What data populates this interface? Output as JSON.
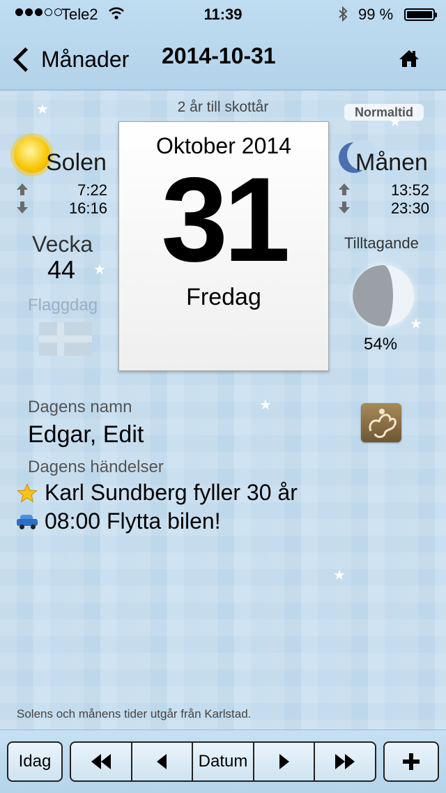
{
  "status_bar": {
    "carrier": "Tele2",
    "time": "11:39",
    "battery_pct": "99 %",
    "signal_bars_filled": 3,
    "signal_bars_total": 5
  },
  "nav": {
    "back_label": "Månader",
    "title": "2014-10-31",
    "home_icon": "home-icon"
  },
  "calendar": {
    "leap_text": "2 år till skottår",
    "month_year": "Oktober 2014",
    "day": "31",
    "weekday": "Fredag"
  },
  "sun": {
    "label": "Solen",
    "rise": "7:22",
    "set": "16:16"
  },
  "week": {
    "label": "Vecka",
    "number": "44"
  },
  "flag": {
    "label": "Flaggdag"
  },
  "moon": {
    "badge": "Normaltid",
    "label": "Månen",
    "rise": "13:52",
    "set": "23:30",
    "phase_label": "Tilltagande",
    "illumination": "54%"
  },
  "day_info": {
    "names_label": "Dagens namn",
    "names": "Edgar, Edit",
    "events_label": "Dagens händelser",
    "events": [
      {
        "icon": "star-icon",
        "text": "Karl Sundberg fyller 30 år"
      },
      {
        "icon": "car-icon",
        "text": "08:00 Flytta bilen!"
      }
    ]
  },
  "footnote": "Solens och månens tider utgår från Karlstad.",
  "toolbar": {
    "today": "Idag",
    "date": "Datum"
  },
  "colors": {
    "background": "#c4dcee",
    "bar": "#b5d4ea"
  }
}
